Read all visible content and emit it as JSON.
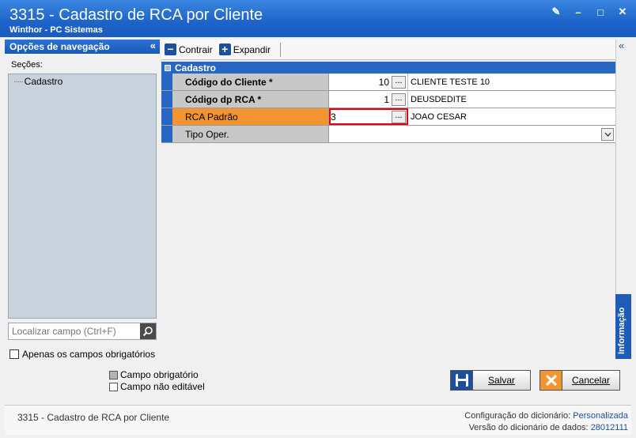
{
  "window": {
    "title": "3315 - Cadastro de RCA por Cliente",
    "subtitle": "Winthor - PC Sistemas",
    "buttons": {
      "edit": "✎",
      "minimize": "–",
      "maximize": "□",
      "close": "✕"
    }
  },
  "nav": {
    "header": "Opções de navegação",
    "collapse": "«",
    "sections_label": "Seções:",
    "tree": [
      {
        "label": "Cadastro"
      }
    ],
    "search_placeholder": "Localizar campo (Ctrl+F)",
    "required_only_label": "Apenas os campos obrigatórios"
  },
  "legend": {
    "required": "Campo obrigatório",
    "readonly": "Campo não editável",
    "required_color": "#b4b4b4",
    "readonly_color": "#ffffff"
  },
  "toolbar": {
    "collapse_label": "Contrair",
    "expand_label": "Expandir",
    "collapse_icon": "−",
    "expand_icon": "+"
  },
  "grid": {
    "section": "Cadastro",
    "rows": [
      {
        "label": "Código do Cliente *",
        "value": "10",
        "description": "CLIENTE TESTE 10"
      },
      {
        "label": "Código dp RCA *",
        "value": "1",
        "description": "DEUSDEDITE"
      },
      {
        "label": "RCA Padrão",
        "value": "3",
        "description": "JOAO CESAR"
      },
      {
        "label": "Tipo Oper.",
        "value": ""
      }
    ],
    "lookup_label": "...",
    "accent": "#f39431",
    "header_color": "#2866c4"
  },
  "info_tab": {
    "label": "Informação",
    "collapse": "«"
  },
  "actions": {
    "save_label": "Salvar",
    "cancel_label": "Cancelar"
  },
  "status": {
    "left": "3315 - Cadastro de RCA por Cliente",
    "config_label": "Configuração do dicionário:",
    "config_value": "Personalizada",
    "version_label": "Versão do dicionário de dados:",
    "version_value": "28012111"
  }
}
